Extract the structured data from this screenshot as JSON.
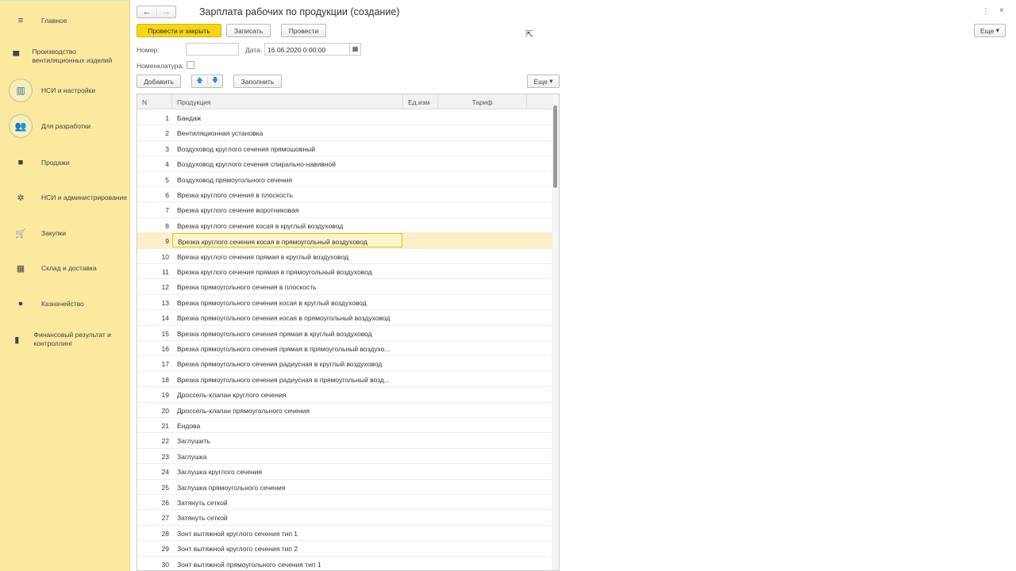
{
  "sidebar": {
    "items": [
      {
        "label": "Главное",
        "icon": "menu-icon"
      },
      {
        "label": "Производство вентиляционных изделий",
        "icon": "ventilation-icon"
      },
      {
        "label": "НСИ и настройки",
        "icon": "settings-round-icon"
      },
      {
        "label": "Для разработки",
        "icon": "developers-icon"
      },
      {
        "label": "Продажи",
        "icon": "bag-icon"
      },
      {
        "label": "НСИ и администрирование",
        "icon": "gear-icon"
      },
      {
        "label": "Закупки",
        "icon": "cart-icon"
      },
      {
        "label": "Склад и доставка",
        "icon": "warehouse-icon"
      },
      {
        "label": "Казначейство",
        "icon": "ruble-icon"
      },
      {
        "label": "Финансовый результат и контроллинг",
        "icon": "chart-icon"
      }
    ]
  },
  "header": {
    "title": "Зарплата рабочих по продукции (создание)",
    "more": "Еще"
  },
  "toolbar": {
    "post_close": "Провести и закрыть",
    "save": "Записать",
    "post": "Провести"
  },
  "form": {
    "number_label": "Номер:",
    "number_value": "",
    "date_label": "Дата:",
    "date_value": "16.06.2020  0:00:00",
    "nomenclature_label": "Номенклатура:"
  },
  "table_toolbar": {
    "add": "Добавить",
    "fill": "Заполнить",
    "more": "Еще"
  },
  "table": {
    "columns": [
      "N",
      "Продукция",
      "Ед.изм",
      "Тариф"
    ],
    "selected_row": 9,
    "rows": [
      "Бандаж",
      "Вентиляционная установка",
      "Воздуховод круглого сечения прямошовный",
      "Воздуховод круглого сечения спирально-навивной",
      "Воздуховод прямоугольного сечения",
      "Врезка круглого сечения в плоскость",
      "Врезка круглого сечения воротниковая",
      "Врезка круглого сечения косая в круглый воздуховод",
      "Врезка круглого сечения косая в прямоугольный воздуховод",
      "Врезка круглого сечения прямая в круглый воздуховод",
      "Врезка круглого сечения прямая в прямоугольный воздуховод",
      "Врезка прямоугольного сечения в плоскость",
      "Врезка прямоугольного сечения косая в круглый воздуховод",
      "Врезка прямоугольного сечения косая в прямоугольный воздуховод",
      "Врезка прямоугольного сечения прямая в круглый воздуховод",
      "Врезка прямоугольного сечения прямая в прямоугольный воздухо...",
      "Врезка прямоугольного сечения радиусная в круглый воздуховод",
      "Врезка прямоугольного сечения радиусная в прямоугольный возд...",
      "Дроссель-клапан круглого сечения",
      "Дроссель-клапан прямоугольного сечения",
      "Ендова",
      "Заглушить",
      "Заглушка",
      "Заглушка круглого сечения",
      "Заглушка прямоугольного сечения",
      "Затянуть сеткой",
      "Затянуть сеткой",
      "Зонт вытяжной круглого сечения тип 1",
      "Зонт вытяжной круглого сечения тип 2",
      "Зонт вытяжной прямоугольного сечения тип 1"
    ]
  }
}
